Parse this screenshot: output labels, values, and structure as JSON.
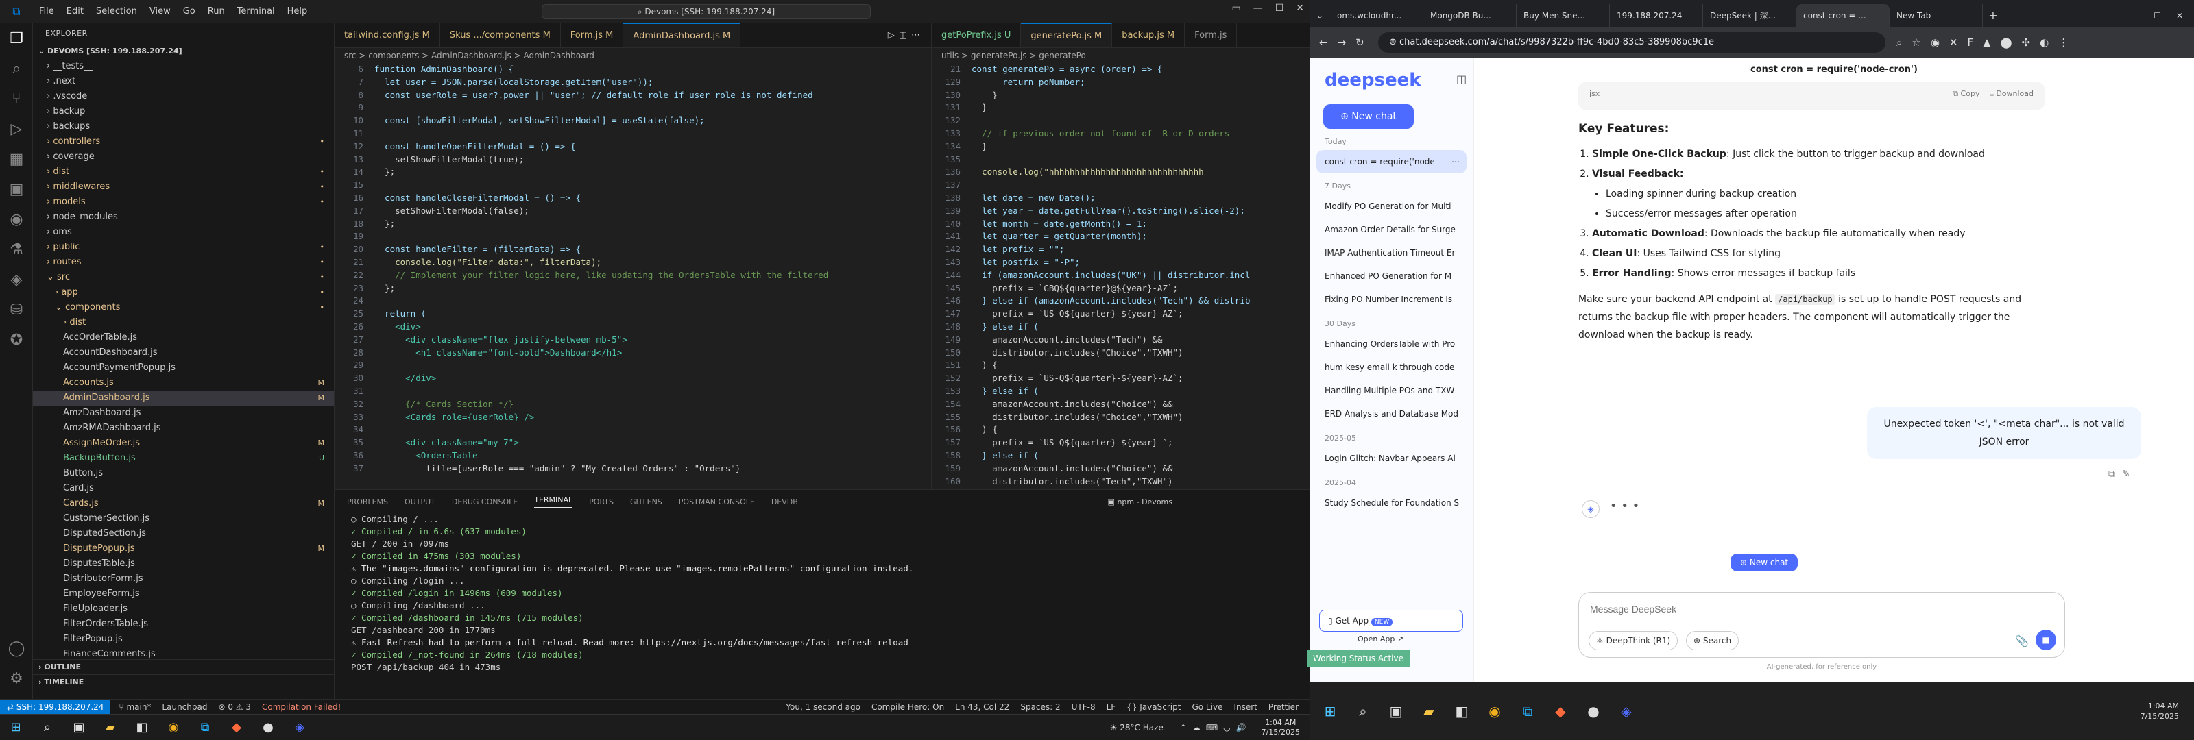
{
  "vscode": {
    "menu": [
      "File",
      "Edit",
      "Selection",
      "View",
      "Go",
      "Run",
      "Terminal",
      "Help"
    ],
    "command_center": "Devoms [SSH: 199.188.207.24]",
    "explorer_title": "EXPLORER",
    "root": "DEVOMS [SSH: 199.188.207.24]",
    "tree": [
      {
        "name": "__tests__",
        "badge": ""
      },
      {
        "name": ".next",
        "badge": ""
      },
      {
        "name": ".vscode",
        "badge": ""
      },
      {
        "name": "backup",
        "badge": ""
      },
      {
        "name": "backups",
        "badge": ""
      },
      {
        "name": "controllers",
        "badge": "•"
      },
      {
        "name": "coverage",
        "badge": ""
      },
      {
        "name": "dist",
        "badge": "•"
      },
      {
        "name": "middlewares",
        "badge": "•"
      },
      {
        "name": "models",
        "badge": "•"
      },
      {
        "name": "node_modules",
        "badge": ""
      },
      {
        "name": "oms",
        "badge": ""
      },
      {
        "name": "public",
        "badge": "•"
      },
      {
        "name": "routes",
        "badge": "•"
      },
      {
        "name": "src",
        "badge": "•"
      },
      {
        "name": "app",
        "badge": "•"
      },
      {
        "name": "components",
        "badge": "•"
      },
      {
        "name": "dist",
        "badge": ""
      },
      {
        "name": "AccOrderTable.js",
        "badge": ""
      },
      {
        "name": "AccountDashboard.js",
        "badge": ""
      },
      {
        "name": "AccountPaymentPopup.js",
        "badge": ""
      },
      {
        "name": "Accounts.js",
        "badge": "M"
      },
      {
        "name": "AdminDashboard.js",
        "badge": "M"
      },
      {
        "name": "AmzDashboard.js",
        "badge": ""
      },
      {
        "name": "AmzRMADashboard.js",
        "badge": ""
      },
      {
        "name": "AssignMeOrder.js",
        "badge": "M"
      },
      {
        "name": "BackupButton.js",
        "badge": "U"
      },
      {
        "name": "Button.js",
        "badge": ""
      },
      {
        "name": "Card.js",
        "badge": ""
      },
      {
        "name": "Cards.js",
        "badge": "M"
      },
      {
        "name": "CustomerSection.js",
        "badge": ""
      },
      {
        "name": "DisputedSection.js",
        "badge": ""
      },
      {
        "name": "DisputePopup.js",
        "badge": "M"
      },
      {
        "name": "DisputesTable.js",
        "badge": ""
      },
      {
        "name": "DistributorForm.js",
        "badge": ""
      },
      {
        "name": "EmployeeForm.js",
        "badge": ""
      },
      {
        "name": "FileUploader.js",
        "badge": ""
      },
      {
        "name": "FilterOrdersTable.js",
        "badge": ""
      },
      {
        "name": "FilterPopup.js",
        "badge": ""
      },
      {
        "name": "FinanceComments.js",
        "badge": ""
      }
    ],
    "outline": "OUTLINE",
    "timeline": "TIMELINE",
    "tabs_left": [
      {
        "label": "tailwind.config.js M"
      },
      {
        "label": "Skus .../components M"
      },
      {
        "label": "Form.js M"
      },
      {
        "label": "AdminDashboard.js M"
      }
    ],
    "tabs_right": [
      {
        "label": "getPoPrefix.js U"
      },
      {
        "label": "generatePo.js M"
      },
      {
        "label": "backup.js M"
      },
      {
        "label": "Form.js"
      }
    ],
    "breadcrumb_left": "src > components > AdminDashboard.js > AdminDashboard",
    "breadcrumb_right": "utils > generatePo.js > generatePo",
    "code_left": [
      {
        "n": "6",
        "t": "function AdminDashboard() {"
      },
      {
        "n": "7",
        "t": "  let user = JSON.parse(localStorage.getItem(\"user\"));"
      },
      {
        "n": "8",
        "t": "  const userRole = user?.power || \"user\"; // default role if user role is not defined"
      },
      {
        "n": "9",
        "t": ""
      },
      {
        "n": "10",
        "t": "  const [showFilterModal, setShowFilterModal] = useState(false);"
      },
      {
        "n": "11",
        "t": ""
      },
      {
        "n": "12",
        "t": "  const handleOpenFilterModal = () => {"
      },
      {
        "n": "13",
        "t": "    setShowFilterModal(true);"
      },
      {
        "n": "14",
        "t": "  };"
      },
      {
        "n": "15",
        "t": ""
      },
      {
        "n": "16",
        "t": "  const handleCloseFilterModal = () => {"
      },
      {
        "n": "17",
        "t": "    setShowFilterModal(false);"
      },
      {
        "n": "18",
        "t": "  };"
      },
      {
        "n": "19",
        "t": ""
      },
      {
        "n": "20",
        "t": "  const handleFilter = (filterData) => {"
      },
      {
        "n": "21",
        "t": "    console.log(\"Filter data:\", filterData);"
      },
      {
        "n": "22",
        "t": "    // Implement your filter logic here, like updating the OrdersTable with the filtered"
      },
      {
        "n": "23",
        "t": "  };"
      },
      {
        "n": "24",
        "t": ""
      },
      {
        "n": "25",
        "t": "  return ("
      },
      {
        "n": "26",
        "t": "    <div>"
      },
      {
        "n": "27",
        "t": "      <div className=\"flex justify-between mb-5\">"
      },
      {
        "n": "28",
        "t": "        <h1 className=\"font-bold\">Dashboard</h1>"
      },
      {
        "n": "29",
        "t": ""
      },
      {
        "n": "30",
        "t": "      </div>"
      },
      {
        "n": "31",
        "t": ""
      },
      {
        "n": "32",
        "t": "      {/* Cards Section */}"
      },
      {
        "n": "33",
        "t": "      <Cards role={userRole} />"
      },
      {
        "n": "34",
        "t": ""
      },
      {
        "n": "35",
        "t": "      <div className=\"my-7\">"
      },
      {
        "n": "36",
        "t": "        <OrdersTable"
      },
      {
        "n": "37",
        "t": "          title={userRole === \"admin\" ? \"My Created Orders\" : \"Orders\"}"
      }
    ],
    "code_right": [
      {
        "n": "21",
        "t": "const generatePo = async (order) => {"
      },
      {
        "n": "129",
        "t": "      return poNumber;"
      },
      {
        "n": "130",
        "t": "    }"
      },
      {
        "n": "131",
        "t": "  }"
      },
      {
        "n": "132",
        "t": ""
      },
      {
        "n": "133",
        "t": "  // if previous order not found of -R or-D orders"
      },
      {
        "n": "134",
        "t": "  }"
      },
      {
        "n": "135",
        "t": ""
      },
      {
        "n": "136",
        "t": "  console.log(\"hhhhhhhhhhhhhhhhhhhhhhhhhhhhhh"
      },
      {
        "n": "137",
        "t": ""
      },
      {
        "n": "138",
        "t": "  let date = new Date();"
      },
      {
        "n": "139",
        "t": "  let year = date.getFullYear().toString().slice(-2);"
      },
      {
        "n": "140",
        "t": "  let month = date.getMonth() + 1;"
      },
      {
        "n": "141",
        "t": "  let quarter = getQuarter(month);"
      },
      {
        "n": "142",
        "t": "  let prefix = \"\";"
      },
      {
        "n": "143",
        "t": "  let postfix = \"-P\";"
      },
      {
        "n": "144",
        "t": "  if (amazonAccount.includes(\"UK\") || distributor.incl"
      },
      {
        "n": "145",
        "t": "    prefix = `GBQ${quarter}@${year}-AZ`;"
      },
      {
        "n": "146",
        "t": "  } else if (amazonAccount.includes(\"Tech\") && distrib"
      },
      {
        "n": "147",
        "t": "    prefix = `US-Q${quarter}-${year}-AZ`;"
      },
      {
        "n": "148",
        "t": "  } else if ("
      },
      {
        "n": "149",
        "t": "    amazonAccount.includes(\"Tech\") &&"
      },
      {
        "n": "150",
        "t": "    distributor.includes(\"Choice\",\"TXWH\")"
      },
      {
        "n": "151",
        "t": "  ) {"
      },
      {
        "n": "152",
        "t": "    prefix = `US-Q${quarter}-${year}-AZ`;"
      },
      {
        "n": "153",
        "t": "  } else if ("
      },
      {
        "n": "154",
        "t": "    amazonAccount.includes(\"Choice\") &&"
      },
      {
        "n": "155",
        "t": "    distributor.includes(\"Choice\",\"TXWH\")"
      },
      {
        "n": "156",
        "t": "  ) {"
      },
      {
        "n": "157",
        "t": "    prefix = `US-Q${quarter}-${year}-`;"
      },
      {
        "n": "158",
        "t": "  } else if ("
      },
      {
        "n": "159",
        "t": "    amazonAccount.includes(\"Choice\") &&"
      },
      {
        "n": "160",
        "t": "    distributor.includes(\"Tech\",\"TXWH\")"
      }
    ],
    "panel_tabs": [
      "PROBLEMS",
      "OUTPUT",
      "DEBUG CONSOLE",
      "TERMINAL",
      "PORTS",
      "GITLENS",
      "POSTMAN CONSOLE",
      "DEVDB"
    ],
    "terminal_label": "npm - Devoms",
    "terminal": [
      "○ Compiling / ...",
      "✓ Compiled / in 6.6s (637 modules)",
      "GET / 200 in 7097ms",
      "✓ Compiled in 475ms (303 modules)",
      "⚠ The \"images.domains\" configuration is deprecated. Please use \"images.remotePatterns\" configuration instead.",
      "○ Compiling /login ...",
      "✓ Compiled /login in 1496ms (609 modules)",
      "○ Compiling /dashboard ...",
      "✓ Compiled /dashboard in 1457ms (715 modules)",
      "GET /dashboard 200 in 1770ms",
      "⚠ Fast Refresh had to perform a full reload. Read more: https://nextjs.org/docs/messages/fast-refresh-reload",
      "✓ Compiled /_not-found in 264ms (718 modules)",
      "POST /api/backup 404 in 473ms"
    ],
    "status": {
      "remote": "SSH: 199.188.207.24",
      "branch": "main*",
      "launchpad": "Launchpad",
      "problems": "⊗ 0 ⚠ 3",
      "compile": "Compilation Failed!",
      "blame": "You, 1 second ago",
      "compile_hero": "Compile Hero: On",
      "position": "Ln 43, Col 22",
      "spaces": "Spaces: 2",
      "encoding": "UTF-8",
      "eol": "LF",
      "lang": "{} JavaScript",
      "golive": "Go Live",
      "insert": "Insert",
      "prettier": "Prettier"
    },
    "weather": "28°C Haze",
    "time_left": "1:04 AM",
    "date_left": "7/15/2025"
  },
  "browser": {
    "tabs": [
      {
        "label": "oms.wcloudhr..."
      },
      {
        "label": "MongoDB Bu..."
      },
      {
        "label": "Buy Men Sne..."
      },
      {
        "label": "199.188.207.24"
      },
      {
        "label": "DeepSeek | 深..."
      },
      {
        "label": "const cron = ..."
      },
      {
        "label": "New Tab"
      }
    ],
    "url": "chat.deepseek.com/a/chat/s/9987322b-ff9c-4bd0-83c5-389908bc9c1e"
  },
  "deepseek": {
    "logo": "deepseek",
    "new_chat": "New chat",
    "today": "Today",
    "active_chat": "const cron = require('node",
    "seven_days": "7 Days",
    "history7": [
      "Modify PO Generation for Multi",
      "Amazon Order Details for Surge",
      "IMAP Authentication Timeout Er",
      "Enhanced PO Generation for M",
      "Fixing PO Number Increment Is"
    ],
    "thirty_days": "30 Days",
    "history30": [
      "Enhancing OrdersTable with Pro",
      "hum kesy email k through code",
      "Handling Multiple POs and TXW",
      "ERD Analysis and Database Mod"
    ],
    "month1": "2025-05",
    "history_m1": [
      "Login Glitch: Navbar Appears Al"
    ],
    "month2": "2025-04",
    "history_m2": [
      "Study Schedule for Foundation S"
    ],
    "get_app": "Get App",
    "new_badge": "NEW",
    "open_app": "Open App",
    "chat_title": "const cron = require('node-cron')",
    "code_lang": "jsx",
    "copy": "Copy",
    "download": "Download",
    "features_title": "Key Features:",
    "f1b": "Simple One-Click Backup",
    "f1": ": Just click the button to trigger backup and download",
    "f2b": "Visual Feedback",
    "f2a": "Loading spinner during backup creation",
    "f2c": "Success/error messages after operation",
    "f3b": "Automatic Download",
    "f3": ": Downloads the backup file automatically when ready",
    "f4b": "Clean UI",
    "f4": ": Uses Tailwind CSS for styling",
    "f5b": "Error Handling",
    "f5": ": Shows error messages if backup fails",
    "note1": "Make sure your backend API endpoint at ",
    "note_code": "/api/backup",
    "note2": " is set up to handle POST requests and returns the backup file with proper headers. The component will automatically trigger the download when the backup is ready.",
    "user_msg": "Unexpected token '<', \"<meta char\"... is not valid JSON error",
    "new_chat_float": "New chat",
    "placeholder": "Message DeepSeek",
    "deepthink": "DeepThink (R1)",
    "search": "Search",
    "disclaimer": "AI-generated, for reference only"
  },
  "work_status": "Working Status Active",
  "time_right": "1:04 AM",
  "date_right": "7/15/2025"
}
